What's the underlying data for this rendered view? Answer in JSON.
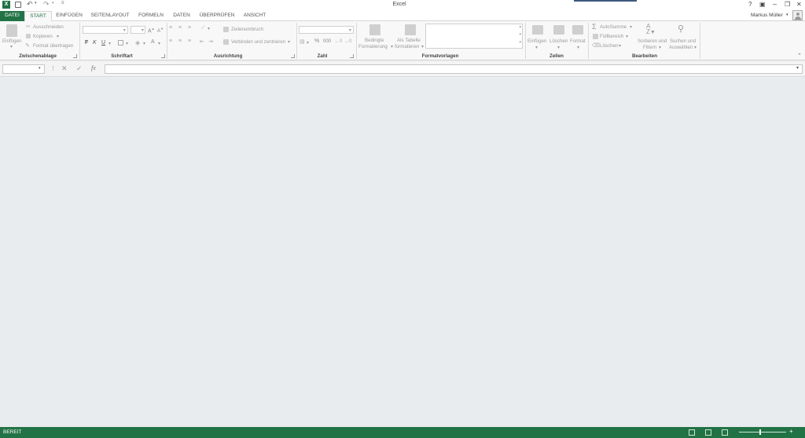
{
  "window": {
    "title": "Excel",
    "user_name": "Markus Müller"
  },
  "qat": {
    "save_icon": "save-icon",
    "undo_icon": "undo-icon",
    "redo_icon": "redo-icon"
  },
  "window_controls": {
    "help": "?",
    "restore_ribbon": "▣",
    "minimize": "–",
    "maximize": "❐",
    "close": "✕"
  },
  "tabs": [
    {
      "label": "DATEI"
    },
    {
      "label": "START"
    },
    {
      "label": "EINFÜGEN"
    },
    {
      "label": "SEITENLAYOUT"
    },
    {
      "label": "FORMELN"
    },
    {
      "label": "DATEN"
    },
    {
      "label": "ÜBERPRÜFEN"
    },
    {
      "label": "ANSICHT"
    }
  ],
  "ribbon": {
    "clipboard": {
      "paste": "Einfügen",
      "cut": "Ausschneiden",
      "copy": "Kopieren",
      "format_painter": "Format übertragen",
      "group": "Zwischenablage"
    },
    "font": {
      "bold": "F",
      "italic": "K",
      "underline": "U",
      "group": "Schriftart"
    },
    "alignment": {
      "wrap": "Zeilenumbruch",
      "merge": "Verbinden und zentrieren",
      "group": "Ausrichtung"
    },
    "number": {
      "percent": "%",
      "thousands": "000",
      "group": "Zahl"
    },
    "styles": {
      "conditional_line1": "Bedingte",
      "conditional_line2": "Formatierung",
      "table_line1": "Als Tabelle",
      "table_line2": "formatieren",
      "group": "Formatvorlagen"
    },
    "cells": {
      "insert": "Einfügen",
      "delete": "Löschen",
      "format": "Format",
      "group": "Zellen"
    },
    "editing": {
      "autosum": "AutoSumme",
      "fill": "Füllbereich",
      "clear": "Löschen",
      "sort_line1": "Sortieren und",
      "sort_line2": "Filtern",
      "find_line1": "Suchen und",
      "find_line2": "Auswählen",
      "group": "Bearbeiten"
    }
  },
  "formula_bar": {
    "name_box": "",
    "formula": "",
    "fx": "fx",
    "cancel": "✕",
    "enter": "✓"
  },
  "status_bar": {
    "mode": "BEREIT"
  },
  "colors": {
    "accent": "#217346",
    "sheet_bg": "#e8ecee",
    "ribbon_bg": "#f8f8f8"
  }
}
